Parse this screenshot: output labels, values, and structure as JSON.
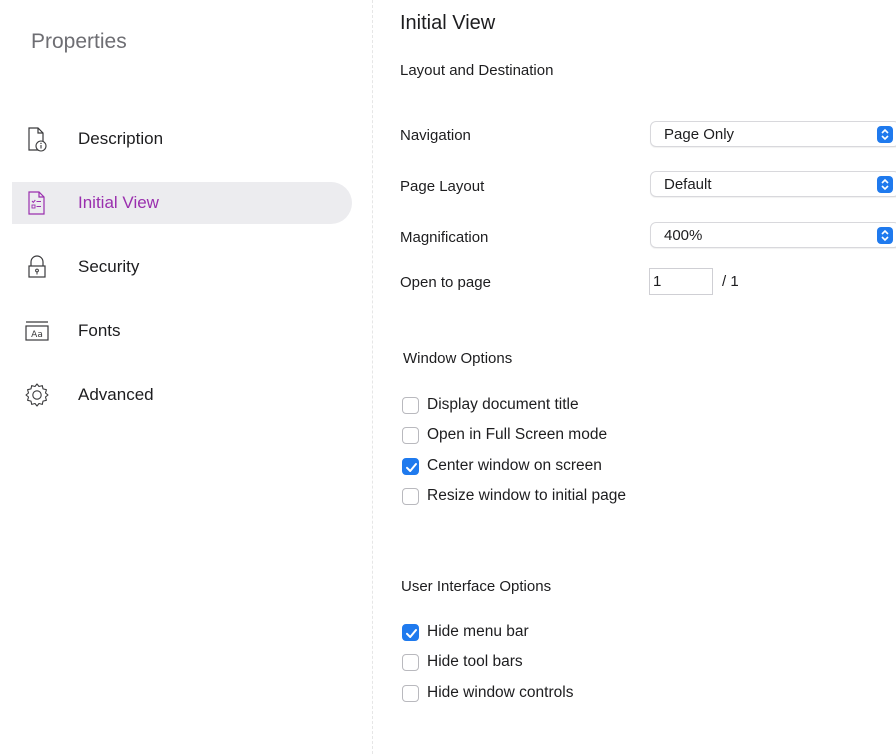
{
  "sidebar": {
    "title": "Properties",
    "items": [
      {
        "label": "Description",
        "icon": "document-info-icon",
        "active": false
      },
      {
        "label": "Initial View",
        "icon": "document-list-icon",
        "active": true
      },
      {
        "label": "Security",
        "icon": "lock-icon",
        "active": false
      },
      {
        "label": "Fonts",
        "icon": "font-icon",
        "active": false
      },
      {
        "label": "Advanced",
        "icon": "gear-icon",
        "active": false
      }
    ]
  },
  "main": {
    "title": "Initial View",
    "layout_section": {
      "title": "Layout and Destination",
      "navigation": {
        "label": "Navigation",
        "value": "Page Only"
      },
      "page_layout": {
        "label": "Page Layout",
        "value": "Default"
      },
      "magnification": {
        "label": "Magnification",
        "value": "400%"
      },
      "open_to_page": {
        "label": "Open to page",
        "value": "1",
        "total": "/ 1"
      }
    },
    "window_options": {
      "title": "Window Options",
      "options": [
        {
          "label": "Display document title",
          "checked": false
        },
        {
          "label": "Open in Full Screen mode",
          "checked": false
        },
        {
          "label": "Center window on screen",
          "checked": true
        },
        {
          "label": "Resize window to initial page",
          "checked": false
        }
      ]
    },
    "ui_options": {
      "title": "User Interface Options",
      "options": [
        {
          "label": "Hide menu bar",
          "checked": true
        },
        {
          "label": "Hide tool bars",
          "checked": false
        },
        {
          "label": "Hide window controls",
          "checked": false
        }
      ]
    }
  },
  "colors": {
    "accent": "#1f7aee",
    "active_nav_text": "#9a2fae",
    "active_nav_bg": "#ececef"
  }
}
